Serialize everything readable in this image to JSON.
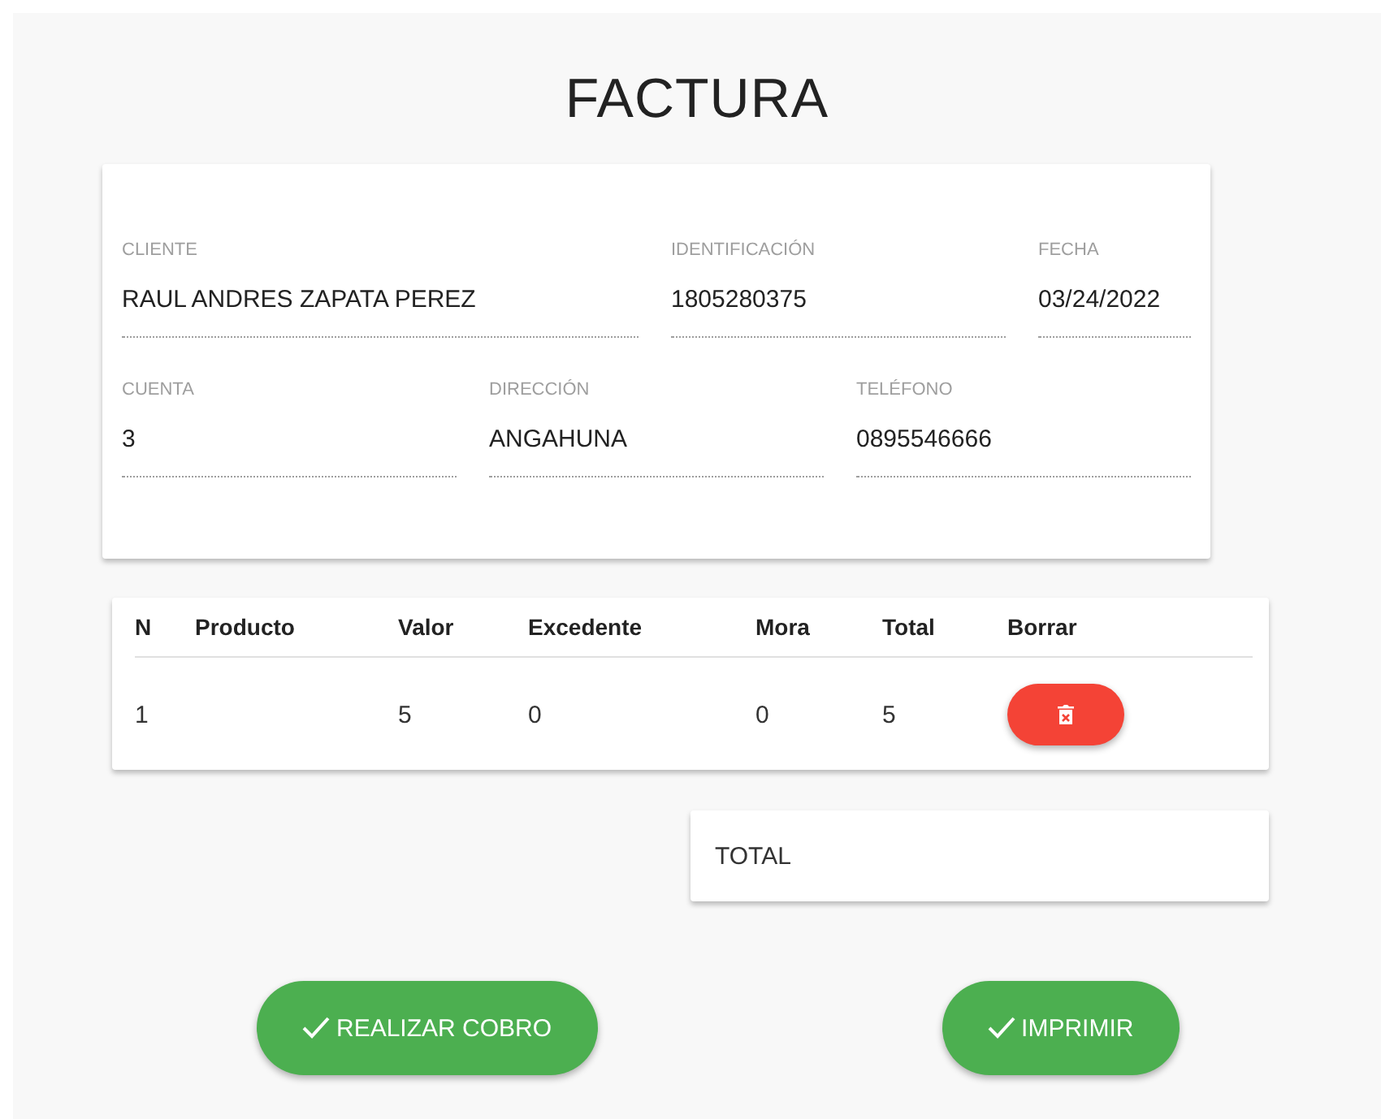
{
  "title": "FACTURA",
  "fields": [
    {
      "label": "CLIENTE",
      "value": "RAUL ANDRES ZAPATA PEREZ"
    },
    {
      "label": "IDENTIFICACIÓN",
      "value": "1805280375"
    },
    {
      "label": "FECHA",
      "value": "03/24/2022"
    },
    {
      "label": "CUENTA",
      "value": "3"
    },
    {
      "label": "DIRECCIÓN",
      "value": "ANGAHUNA"
    },
    {
      "label": "TELÉFONO",
      "value": "0895546666"
    }
  ],
  "table": {
    "columns": [
      "N",
      "Producto",
      "Valor",
      "Excedente",
      "Mora",
      "Total",
      "Borrar"
    ],
    "rows": [
      {
        "cells": [
          "1",
          "",
          "5",
          "0",
          "0",
          "5"
        ]
      }
    ]
  },
  "total_label": "TOTAL",
  "buttons": [
    "REALIZAR COBRO",
    "IMPRIMIR"
  ]
}
